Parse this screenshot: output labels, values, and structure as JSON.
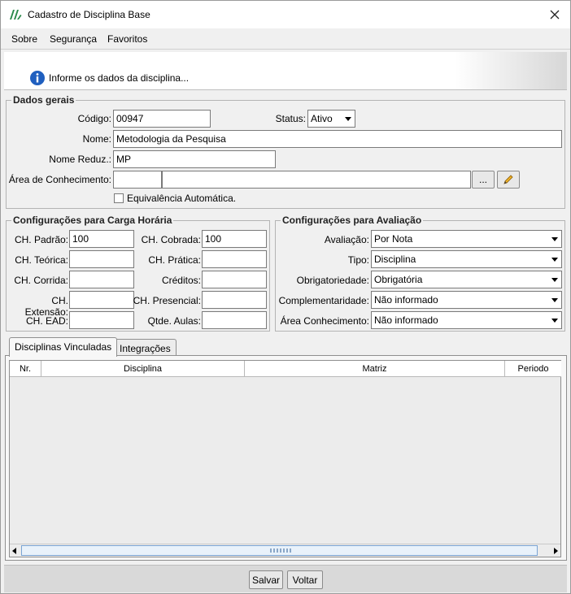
{
  "window": {
    "title": "Cadastro de Disciplina Base"
  },
  "menu": {
    "items": [
      "Sobre",
      "Segurança",
      "Favoritos"
    ]
  },
  "banner": {
    "text": "Informe os dados da disciplina..."
  },
  "dados_gerais": {
    "legend": "Dados gerais",
    "codigo_label": "Código:",
    "codigo_value": "00947",
    "status_label": "Status:",
    "status_value": "Ativo",
    "nome_label": "Nome:",
    "nome_value": "Metodologia da Pesquisa",
    "nome_reduz_label": "Nome Reduz.:",
    "nome_reduz_value": "MP",
    "area_label": "Área de Conhecimento:",
    "area_code_value": "",
    "area_desc_value": "",
    "browse_label": "...",
    "equivalencia_label": "Equivalência Automática.",
    "equivalencia_checked": false
  },
  "carga_horaria": {
    "legend": "Configurações para Carga Horária",
    "ch_padrao_label": "CH. Padrão:",
    "ch_padrao_value": "100",
    "ch_cobrada_label": "CH. Cobrada:",
    "ch_cobrada_value": "100",
    "ch_teorica_label": "CH. Teórica:",
    "ch_teorica_value": "",
    "ch_pratica_label": "CH. Prática:",
    "ch_pratica_value": "",
    "ch_corrida_label": "CH. Corrida:",
    "ch_corrida_value": "",
    "creditos_label": "Créditos:",
    "creditos_value": "",
    "ch_extensao_label": "CH. Extensão:",
    "ch_extensao_value": "",
    "ch_presencial_label": "CH. Presencial:",
    "ch_presencial_value": "",
    "ch_ead_label": "CH. EAD:",
    "ch_ead_value": "",
    "qtde_aulas_label": "Qtde. Aulas:",
    "qtde_aulas_value": ""
  },
  "avaliacao": {
    "legend": "Configurações para Avaliação",
    "avaliacao_label": "Avaliação:",
    "avaliacao_value": "Por Nota",
    "tipo_label": "Tipo:",
    "tipo_value": "Disciplina",
    "obrigatoriedade_label": "Obrigatoriedade:",
    "obrigatoriedade_value": "Obrigatória",
    "complementaridade_label": "Complementaridade:",
    "complementaridade_value": "Não informado",
    "area_conhecimento_label": "Área Conhecimento:",
    "area_conhecimento_value": "Não informado"
  },
  "tabs": [
    {
      "label": "Disciplinas Vinculadas",
      "active": true
    },
    {
      "label": "Integrações",
      "active": false
    }
  ],
  "grid": {
    "columns": [
      "Nr.",
      "Disciplina",
      "Matriz",
      "Periodo"
    ],
    "rows": []
  },
  "footer": {
    "salvar_label": "Salvar",
    "voltar_label": "Voltar"
  }
}
